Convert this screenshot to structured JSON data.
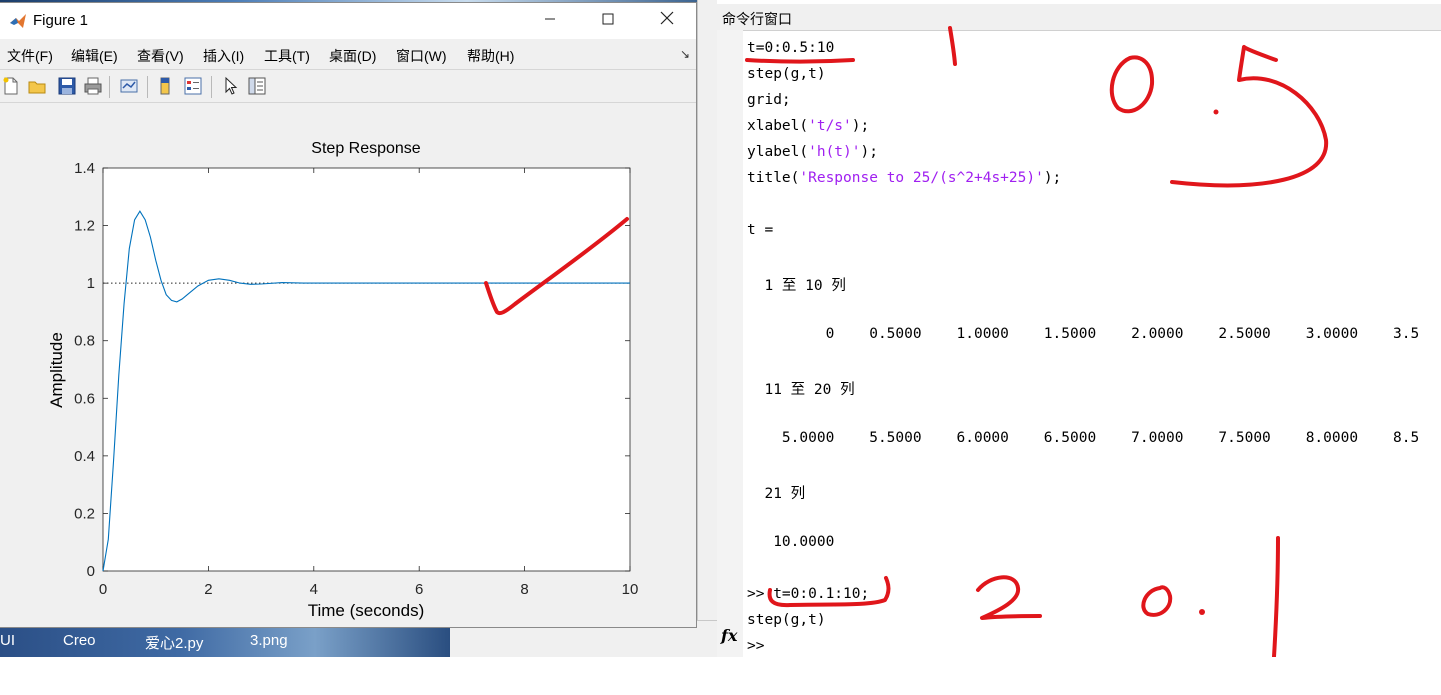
{
  "figure_window": {
    "title": "Figure 1",
    "menu": [
      "文件(F)",
      "编辑(E)",
      "查看(V)",
      "插入(I)",
      "工具(T)",
      "桌面(D)",
      "窗口(W)",
      "帮助(H)"
    ],
    "toolbar_icons": [
      "new-figure-icon",
      "open-file-icon",
      "save-icon",
      "print-icon",
      "link-plot-icon",
      "colorbar-icon",
      "legend-icon",
      "pointer-icon",
      "property-inspector-icon"
    ]
  },
  "chart_data": {
    "type": "line",
    "title": "Step Response",
    "xlabel": "Time (seconds)",
    "ylabel": "Amplitude",
    "xlim": [
      0,
      10
    ],
    "ylim": [
      0,
      1.4
    ],
    "xticks": [
      "0",
      "2",
      "4",
      "6",
      "8",
      "10"
    ],
    "yticks": [
      "0",
      "0.2",
      "0.4",
      "0.6",
      "0.8",
      "1",
      "1.2",
      "1.4"
    ],
    "grid": false,
    "reference_line": 1,
    "series": [
      {
        "x": [
          0,
          0.1,
          0.2,
          0.3,
          0.4,
          0.5,
          0.6,
          0.7,
          0.8,
          0.9,
          1.0,
          1.1,
          1.2,
          1.3,
          1.4,
          1.5,
          1.6,
          1.8,
          2.0,
          2.2,
          2.4,
          2.6,
          2.8,
          3.0,
          3.4,
          3.8,
          4.2,
          5.0,
          6.0,
          7.0,
          8.0,
          9.0,
          10.0
        ],
        "y": [
          0,
          0.11,
          0.38,
          0.68,
          0.93,
          1.12,
          1.22,
          1.25,
          1.22,
          1.16,
          1.08,
          1.01,
          0.96,
          0.94,
          0.935,
          0.945,
          0.96,
          0.99,
          1.01,
          1.015,
          1.01,
          1.0,
          0.996,
          0.997,
          1.002,
          1.0,
          1.0,
          1.0,
          1.0,
          1.0,
          1.0,
          1.0,
          1.0
        ]
      }
    ]
  },
  "desktop": {
    "icons": [
      "UI",
      "Creo",
      "爱心2.py",
      "3.png"
    ]
  },
  "command_window": {
    "title": "命令行窗口",
    "lines": [
      "t=0:0.5:10",
      "step(g,t)",
      "grid;",
      "",
      "",
      "",
      "",
      "t =",
      "",
      "  1 至 10 列",
      "",
      "         0    0.5000    1.0000    1.5000    2.0000    2.5000    3.0000    3.5",
      "",
      "  11 至 20 列",
      "",
      "    5.0000    5.5000    6.0000    6.5000    7.0000    7.5000    8.0000    8.5",
      "",
      "  21 列",
      "",
      "   10.0000",
      "",
      ">> t=0:0.1:10;",
      "step(g,t)",
      ">>"
    ],
    "xlabel_cmd": {
      "pre": "xlabel(",
      "str": "'t/s'",
      "post": ");"
    },
    "ylabel_cmd": {
      "pre": "ylabel(",
      "str": "'h(t)'",
      "post": ");"
    },
    "title_cmd": {
      "pre": "title(",
      "str": "'Response to 25/(s^2+4s+25)'",
      "post": ");"
    },
    "fx_label": "fx"
  },
  "annotations": {
    "color": "#e0161b",
    "handwritten": [
      "1",
      "0.5",
      "2",
      "0.1"
    ]
  }
}
